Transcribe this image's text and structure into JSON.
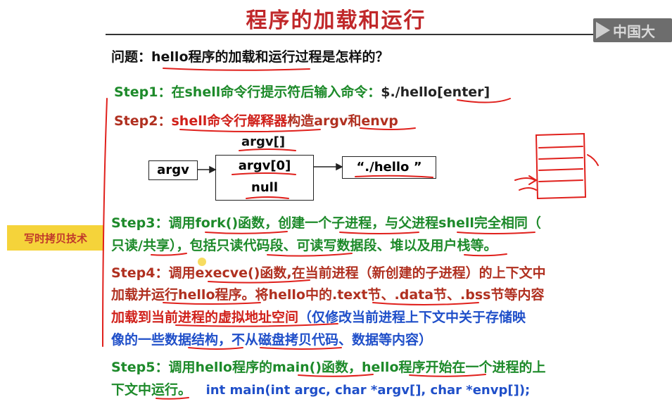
{
  "title": "程序的加载和运行",
  "logo": {
    "text": "中国大"
  },
  "question": "问题：hello程序的加载和运行过程是怎样的？",
  "steps": {
    "step1": {
      "label": "Step1：",
      "text_green": "在shell命令行提示符后输入命令：",
      "text_dark": "$./hello[enter]"
    },
    "step2": {
      "label": "Step2：",
      "text_red": "shell命令行解释器",
      "text_dark": "构造argv和envp"
    },
    "step3": {
      "label": "Step3：",
      "line1": "调用fork()函数，创建一个子进程，与父进程shell完全相同（",
      "line2": "只读/共享），包括只读代码段、可读写数据段、堆以及用户栈等。"
    },
    "step4": {
      "label": "Step4：",
      "line1": "调用execve()函数,在当前进程（新创建的子进程）的上下文中",
      "line2": "加载并运行hello程序。将hello中的.text节、.data节、.bss节等内容",
      "line3_red": "加载到当前进程的虚拟地址空间",
      "line3_blue": "（仅修改当前进程上下文中关于存储映",
      "line4_blue": "像的一些数据结构，不从磁盘拷贝代码、数据等内容）"
    },
    "step5": {
      "label": "Step5：",
      "line1": "调用hello程序的main()函数，hello程序开始在一个进程的上",
      "line2": "下文中运行。",
      "code": "int main(int argc, char *argv[], char *envp[]);"
    }
  },
  "diagram": {
    "argv_box": "argv",
    "array_label": "argv[]",
    "cell0": "argv[0]",
    "cell1": "null",
    "string_box": "“./hello ”"
  },
  "badge": "写时拷贝技术",
  "colors": {
    "green": "#1d8a2a",
    "red": "#b03020",
    "blue": "#1f4fc9",
    "dark": "#222222",
    "title_red": "#c0282a",
    "annotation_red": "#e0201c"
  }
}
